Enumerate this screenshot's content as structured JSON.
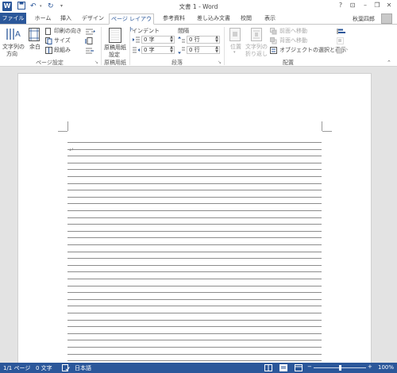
{
  "titlebar": {
    "title": "文書 1 - Word",
    "help": "?",
    "minimize": "–",
    "restore": "❐",
    "close": "✕",
    "ribbon_display": "⊡"
  },
  "tabs": [
    {
      "label": "ファイル"
    },
    {
      "label": "ホーム"
    },
    {
      "label": "挿入"
    },
    {
      "label": "デザイン"
    },
    {
      "label": "ページ レイアウト"
    },
    {
      "label": "参考資料"
    },
    {
      "label": "差し込み文書"
    },
    {
      "label": "校閲"
    },
    {
      "label": "表示"
    }
  ],
  "user_name": "秋葉四郎",
  "ribbon": {
    "page_setup": {
      "label": "ページ設定",
      "text_direction_1": "文字列の",
      "text_direction_2": "方向",
      "margins": "余白",
      "orientation": "印刷の向き",
      "size": "サイズ",
      "columns": "段組み"
    },
    "genko": {
      "label": "原稿用紙",
      "button_1": "原稿用紙",
      "button_2": "設定"
    },
    "paragraph": {
      "label": "段落",
      "indent": "インデント",
      "spacing": "間隔",
      "indent_left": "0 字",
      "indent_right": "0 字",
      "space_before": "0 行",
      "space_after": "0 行"
    },
    "arrange": {
      "label": "配置",
      "position": "位置",
      "wrap_1": "文字列の",
      "wrap_2": "折り返し",
      "bring_forward": "前面へ移動",
      "send_backward": "背面へ移動",
      "selection_pane": "オブジェクトの選択と表示"
    }
  },
  "status": {
    "page": "1/1 ページ",
    "words": "0 文字",
    "language": "日本語",
    "zoom": "100%",
    "zoom_minus": "−",
    "zoom_plus": "+"
  },
  "zoom_level": 1.0,
  "accent_color": "#2b579a"
}
